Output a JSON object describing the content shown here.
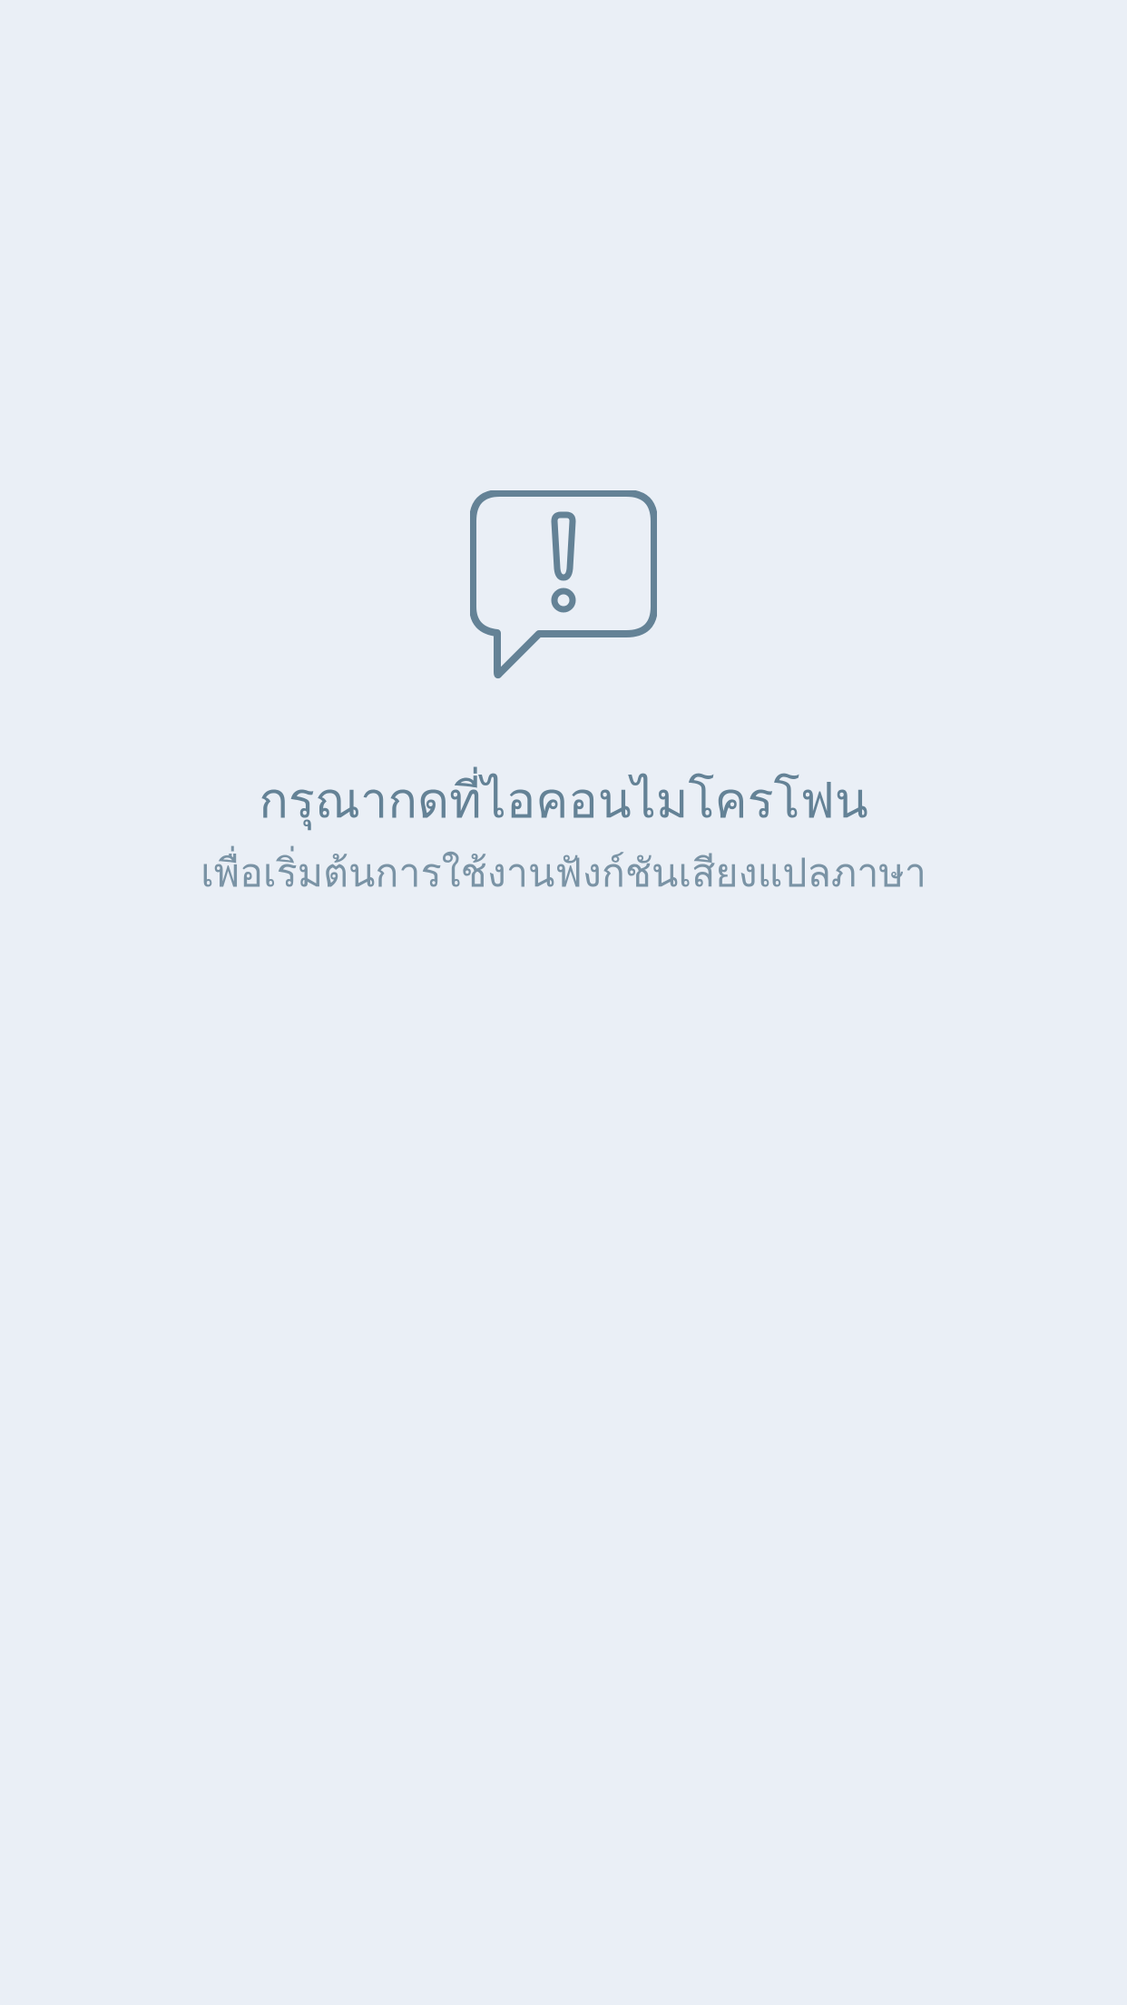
{
  "empty_state": {
    "icon": "speech-bubble-alert-icon",
    "title": "กรุณากดที่ไอคอนไมโครโฟน",
    "subtitle": "เพื่อเริ่มต้นการใช้งานฟังก์ชันเสียงแปลภาษา"
  },
  "colors": {
    "background": "#eaeff6",
    "icon": "#648296",
    "title": "#648296",
    "subtitle": "#7a93a5"
  }
}
